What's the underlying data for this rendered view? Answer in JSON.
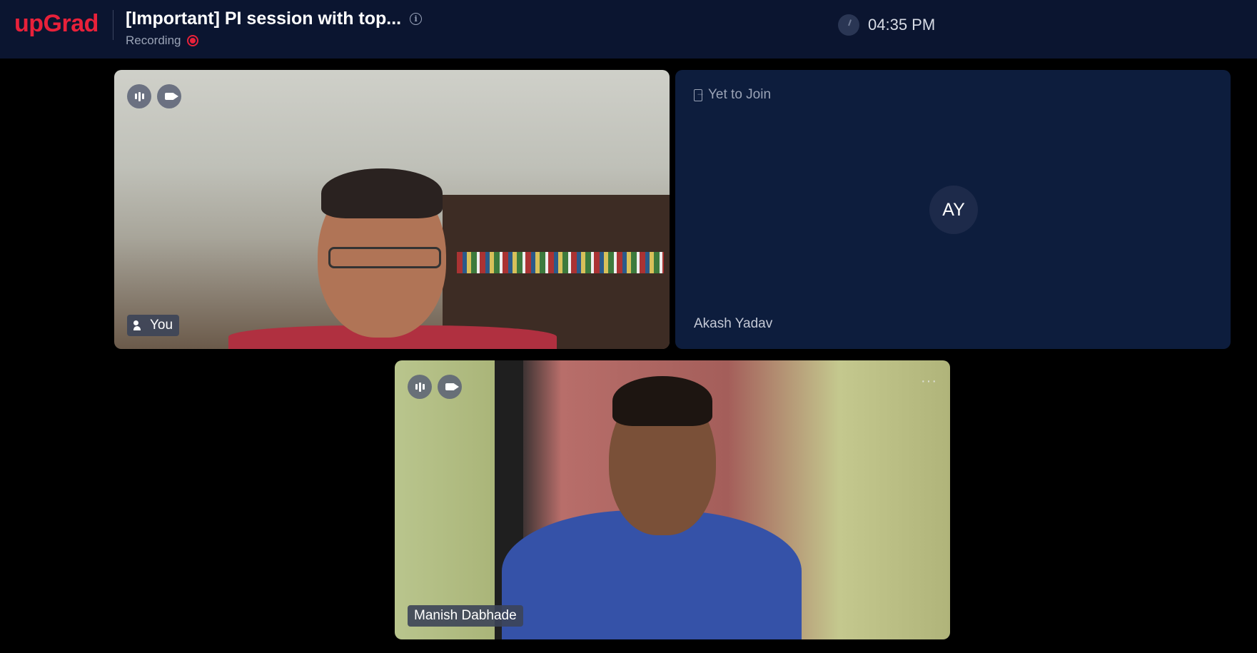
{
  "header": {
    "logo": "upGrad",
    "title": "[Important] PI session with top...",
    "recording_label": "Recording",
    "time": "04:35 PM"
  },
  "tiles": {
    "you": {
      "name": "You"
    },
    "akash": {
      "status": "Yet to Join",
      "initials": "AY",
      "name": "Akash Yadav"
    },
    "manish": {
      "name": "Manish Dabhade",
      "more": "···"
    }
  },
  "icons": {
    "info": "info-icon",
    "recording": "recording-indicator-icon",
    "clock": "clock-icon",
    "audio": "audio-bars-icon",
    "video": "video-camera-icon",
    "speaker": "speaker-user-icon",
    "join": "join-door-icon",
    "more": "more-options-icon"
  },
  "colors": {
    "brand": "#e8213a",
    "header_bg": "#0b1530",
    "tile_bg": "#0d1d3d"
  }
}
